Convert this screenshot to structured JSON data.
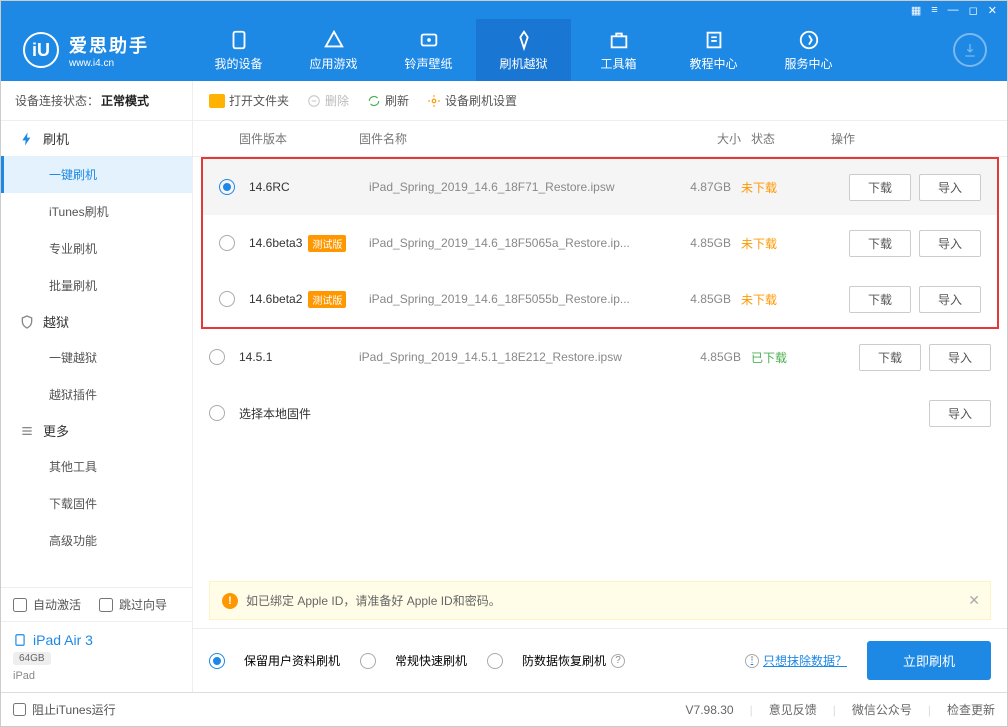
{
  "titlebar_icons": [
    "gift",
    "list",
    "min",
    "max",
    "close"
  ],
  "logo": {
    "title": "爱思助手",
    "url": "www.i4.cn",
    "badge": "iU"
  },
  "nav": [
    {
      "label": "我的设备"
    },
    {
      "label": "应用游戏"
    },
    {
      "label": "铃声壁纸"
    },
    {
      "label": "刷机越狱",
      "active": true
    },
    {
      "label": "工具箱"
    },
    {
      "label": "教程中心"
    },
    {
      "label": "服务中心"
    }
  ],
  "status": {
    "label": "设备连接状态：",
    "value": "正常模式"
  },
  "sidebar": {
    "sections": [
      {
        "title": "刷机",
        "icon": "flash",
        "subs": [
          {
            "label": "一键刷机",
            "active": true
          },
          {
            "label": "iTunes刷机"
          },
          {
            "label": "专业刷机"
          },
          {
            "label": "批量刷机"
          }
        ]
      },
      {
        "title": "越狱",
        "icon": "shield",
        "subs": [
          {
            "label": "一键越狱"
          },
          {
            "label": "越狱插件"
          }
        ]
      },
      {
        "title": "更多",
        "icon": "more",
        "subs": [
          {
            "label": "其他工具"
          },
          {
            "label": "下载固件"
          },
          {
            "label": "高级功能"
          }
        ]
      }
    ],
    "auto_activate": "自动激活",
    "skip_wizard": "跳过向导",
    "device": {
      "name": "iPad Air 3",
      "storage": "64GB",
      "model": "iPad"
    }
  },
  "toolbar": {
    "open": "打开文件夹",
    "delete": "删除",
    "refresh": "刷新",
    "settings": "设备刷机设置"
  },
  "columns": {
    "version": "固件版本",
    "name": "固件名称",
    "size": "大小",
    "status": "状态",
    "ops": "操作"
  },
  "rows": [
    {
      "sel": true,
      "version": "14.6RC",
      "beta": false,
      "name": "iPad_Spring_2019_14.6_18F71_Restore.ipsw",
      "size": "4.87GB",
      "status": "未下载",
      "st": "not",
      "ops": [
        "下载",
        "导入"
      ],
      "hl": true
    },
    {
      "sel": false,
      "version": "14.6beta3",
      "beta": true,
      "name": "iPad_Spring_2019_14.6_18F5065a_Restore.ip...",
      "size": "4.85GB",
      "status": "未下载",
      "st": "not",
      "ops": [
        "下载",
        "导入"
      ],
      "hl": true
    },
    {
      "sel": false,
      "version": "14.6beta2",
      "beta": true,
      "name": "iPad_Spring_2019_14.6_18F5055b_Restore.ip...",
      "size": "4.85GB",
      "status": "未下载",
      "st": "not",
      "ops": [
        "下载",
        "导入"
      ],
      "hl": true
    },
    {
      "sel": false,
      "version": "14.5.1",
      "beta": false,
      "name": "iPad_Spring_2019_14.5.1_18E212_Restore.ipsw",
      "size": "4.85GB",
      "status": "已下载",
      "st": "done",
      "ops": [
        "下载",
        "导入"
      ],
      "hl": false
    },
    {
      "sel": false,
      "version": "选择本地固件",
      "beta": false,
      "name": "",
      "size": "",
      "status": "",
      "st": "",
      "ops": [
        "导入"
      ],
      "hl": false
    }
  ],
  "beta_tag": "测试版",
  "notice": "如已绑定 Apple ID，请准备好 Apple ID和密码。",
  "flash_opts": [
    {
      "label": "保留用户资料刷机",
      "sel": true
    },
    {
      "label": "常规快速刷机",
      "sel": false
    },
    {
      "label": "防数据恢复刷机",
      "sel": false
    }
  ],
  "erase_link": "只想抹除数据？",
  "flash_btn": "立即刷机",
  "footer": {
    "block_itunes": "阻止iTunes运行",
    "version": "V7.98.30",
    "feedback": "意见反馈",
    "wechat": "微信公众号",
    "update": "检查更新"
  }
}
